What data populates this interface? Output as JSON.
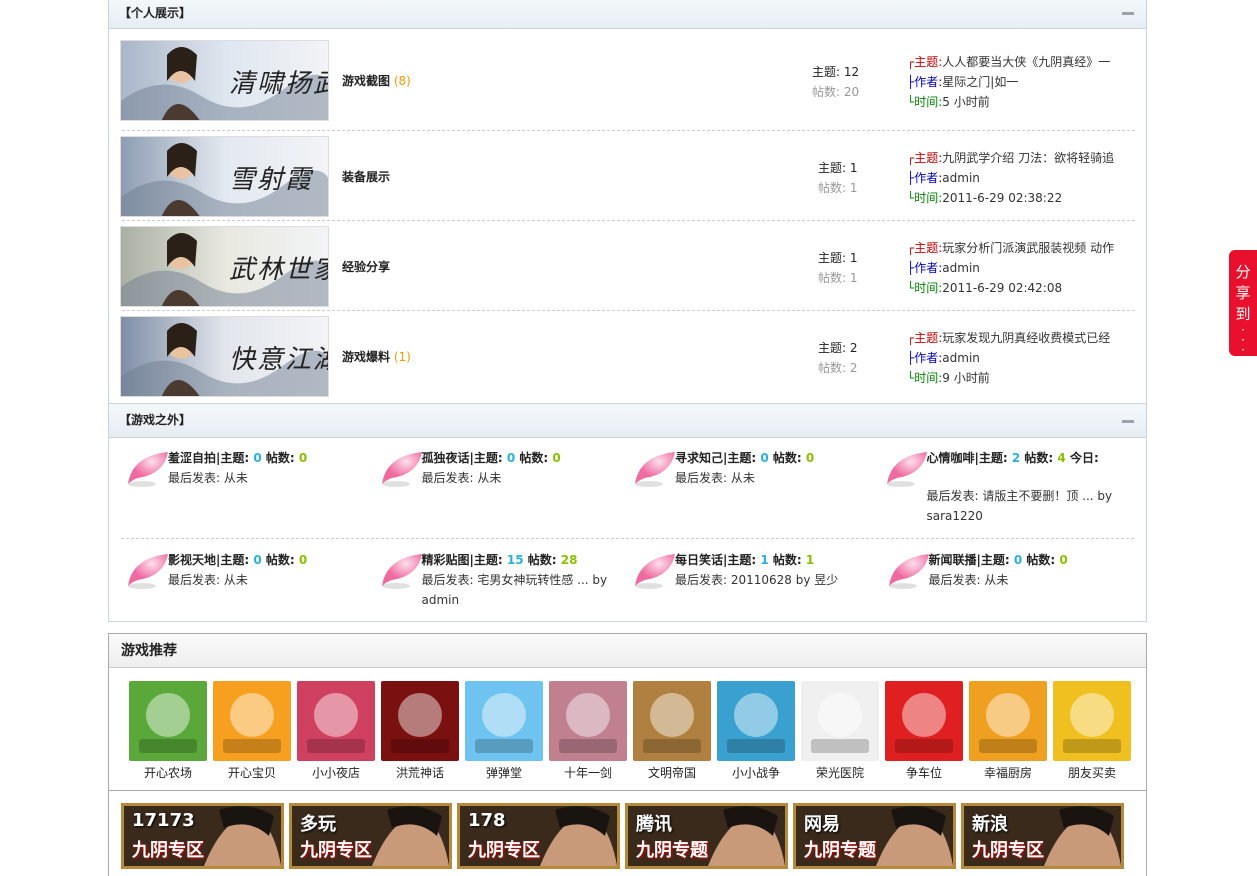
{
  "personal": {
    "title": "【个人展示】",
    "forums": [
      {
        "name": "游戏截图",
        "new": "(8)",
        "topics_label": "主题:",
        "topics": "12",
        "posts_label": "帖数:",
        "posts": "20",
        "thumb_text": "清啸扬武",
        "last": {
          "subject_label": "┌主题:",
          "subject": "人人都要当大侠《九阴真经》一",
          "author_label": "├作者:",
          "author": "星际之门|如一",
          "time_label": "└时间:",
          "time": "5 小时前"
        }
      },
      {
        "name": "装备展示",
        "new": "",
        "topics_label": "主题:",
        "topics": "1",
        "posts_label": "帖数:",
        "posts": "1",
        "thumb_text": "雪射霞",
        "last": {
          "subject_label": "┌主题:",
          "subject": "九阴武学介绍 刀法：欲将轻骑追",
          "author_label": "├作者:",
          "author": "admin",
          "time_label": "└时间:",
          "time": "2011-6-29 02:38:22"
        }
      },
      {
        "name": "经验分享",
        "new": "",
        "topics_label": "主题:",
        "topics": "1",
        "posts_label": "帖数:",
        "posts": "1",
        "thumb_text": "武林世家",
        "last": {
          "subject_label": "┌主题:",
          "subject": "玩家分析门派演武服装视频 动作",
          "author_label": "├作者:",
          "author": "admin",
          "time_label": "└时间:",
          "time": "2011-6-29 02:42:08"
        }
      },
      {
        "name": "游戏爆料",
        "new": "(1)",
        "topics_label": "主题:",
        "topics": "2",
        "posts_label": "帖数:",
        "posts": "2",
        "thumb_text": "快意江湖",
        "last": {
          "subject_label": "┌主题:",
          "subject": "玩家发现九阴真经收费模式已经",
          "author_label": "├作者:",
          "author": "admin",
          "time_label": "└时间:",
          "time": "9 小时前"
        }
      }
    ]
  },
  "outside": {
    "title": "【游戏之外】",
    "boards": [
      {
        "name": "羞涩自拍",
        "topics": "0",
        "posts": "0",
        "today": "",
        "last": "最后发表: 从未"
      },
      {
        "name": "孤独夜话",
        "topics": "0",
        "posts": "0",
        "today": "",
        "last": "最后发表: 从未"
      },
      {
        "name": "寻求知己",
        "topics": "0",
        "posts": "0",
        "today": "",
        "last": "最后发表: 从未"
      },
      {
        "name": "心情咖啡",
        "topics": "2",
        "posts": "4",
        "today": " 今日:",
        "last": "最后发表: 请版主不要删！顶 ... by sara1220"
      },
      {
        "name": "影视天地",
        "topics": "0",
        "posts": "0",
        "today": "",
        "last": "最后发表: 从未"
      },
      {
        "name": "精彩贴图",
        "topics": "15",
        "posts": "28",
        "today": "",
        "last": "最后发表: 宅男女神玩转性感 ... by admin"
      },
      {
        "name": "每日笑话",
        "topics": "1",
        "posts": "1",
        "today": "",
        "last": "最后发表: 20110628 by 昱少"
      },
      {
        "name": "新闻联播",
        "topics": "0",
        "posts": "0",
        "today": "",
        "last": "最后发表: 从未"
      }
    ],
    "sep": "|主题: ",
    "posts_label": " 帖数: "
  },
  "recommend": {
    "title": "游戏推荐",
    "games": [
      {
        "label": "开心农场",
        "color": "#5aa83a",
        "icon": "five-minutes-icon"
      },
      {
        "label": "开心宝贝",
        "color": "#f7a020",
        "icon": "bunny-icon"
      },
      {
        "label": "小小夜店",
        "color": "#d04060",
        "icon": "nightclub-icon"
      },
      {
        "label": "洪荒神话",
        "color": "#7a1010",
        "icon": "myth-icon"
      },
      {
        "label": "弹弹堂",
        "color": "#6fc3f0",
        "icon": "ddt-icon"
      },
      {
        "label": "十年一剑",
        "color": "#c08090",
        "icon": "sword-icon"
      },
      {
        "label": "文明帝国",
        "color": "#b08040",
        "icon": "empire-icon"
      },
      {
        "label": "小小战争",
        "color": "#3aa0d0",
        "icon": "war-icon"
      },
      {
        "label": "荣光医院",
        "color": "#f0f0f0",
        "icon": "hospital-icon"
      },
      {
        "label": "争车位",
        "color": "#e02020",
        "icon": "parking-icon"
      },
      {
        "label": "幸福厨房",
        "color": "#f0a020",
        "icon": "kitchen-icon"
      },
      {
        "label": "朋友买卖",
        "color": "#f0c020",
        "icon": "friends-trade-icon"
      }
    ]
  },
  "zones": [
    {
      "top": "17173",
      "bottom": "九阴专区"
    },
    {
      "top": "多玩",
      "bottom": "九阴专区"
    },
    {
      "top": "178",
      "bottom": "九阴专区"
    },
    {
      "top": "腾讯",
      "bottom": "九阴专题"
    },
    {
      "top": "网易",
      "bottom": "九阴专题"
    },
    {
      "top": "新浪",
      "bottom": "九阴专区"
    }
  ],
  "share": {
    "label": "分享到"
  }
}
